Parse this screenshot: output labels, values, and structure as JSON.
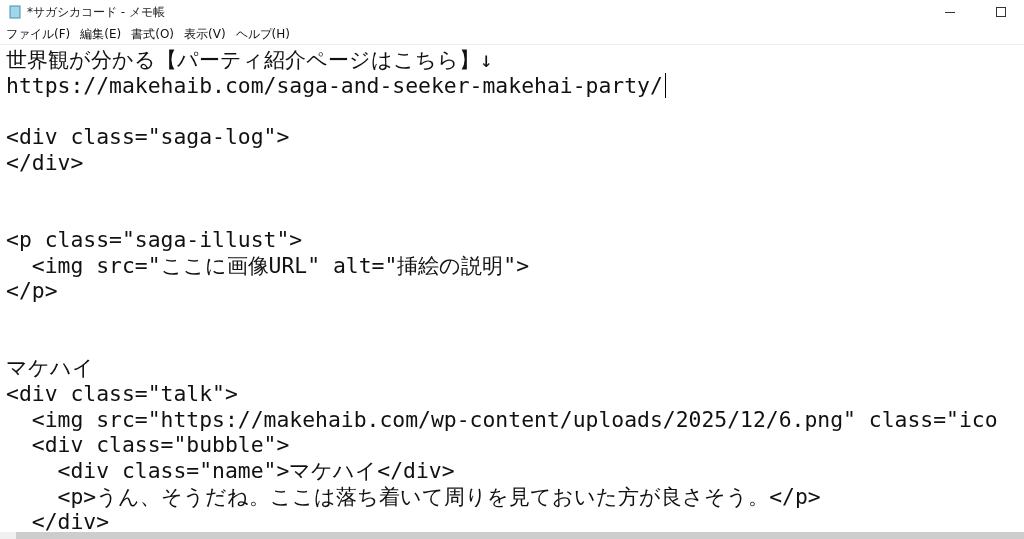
{
  "window": {
    "title": "*サガシカコード - メモ帳"
  },
  "menu": [
    "ファイル(F)",
    "編集(E)",
    "書式(O)",
    "表示(V)",
    "ヘルプ(H)"
  ],
  "lines": [
    {
      "kind": "text",
      "text": "世界観が分かる【パーティ紹介ページはこちら】↓",
      "caret": false
    },
    {
      "kind": "text",
      "text": "https://makehaib.com/saga-and-seeker-makehai-party/",
      "caret": true
    },
    {
      "kind": "blank"
    },
    {
      "kind": "text",
      "text": "<div class=\"saga-log\">",
      "caret": false
    },
    {
      "kind": "text",
      "text": "</div>",
      "caret": false
    },
    {
      "kind": "blank"
    },
    {
      "kind": "blank"
    },
    {
      "kind": "text",
      "text": "<p class=\"saga-illust\">",
      "caret": false
    },
    {
      "kind": "text",
      "text": "  <img src=\"ここに画像URL\" alt=\"挿絵の説明\">",
      "caret": false
    },
    {
      "kind": "text",
      "text": "</p>",
      "caret": false
    },
    {
      "kind": "blank"
    },
    {
      "kind": "blank"
    },
    {
      "kind": "text",
      "text": "マケハイ",
      "caret": false
    },
    {
      "kind": "text",
      "text": "<div class=\"talk\">",
      "caret": false
    },
    {
      "kind": "text",
      "text": "  <img src=\"https://makehaib.com/wp-content/uploads/2025/12/6.png\" class=\"ico",
      "caret": false
    },
    {
      "kind": "text",
      "text": "  <div class=\"bubble\">",
      "caret": false
    },
    {
      "kind": "text",
      "text": "    <div class=\"name\">マケハイ</div>",
      "caret": false
    },
    {
      "kind": "text",
      "text": "    <p>うん、そうだね。ここは落ち着いて周りを見ておいた方が良さそう。</p>",
      "caret": false
    },
    {
      "kind": "text",
      "text": "  </div>",
      "caret": false
    }
  ]
}
